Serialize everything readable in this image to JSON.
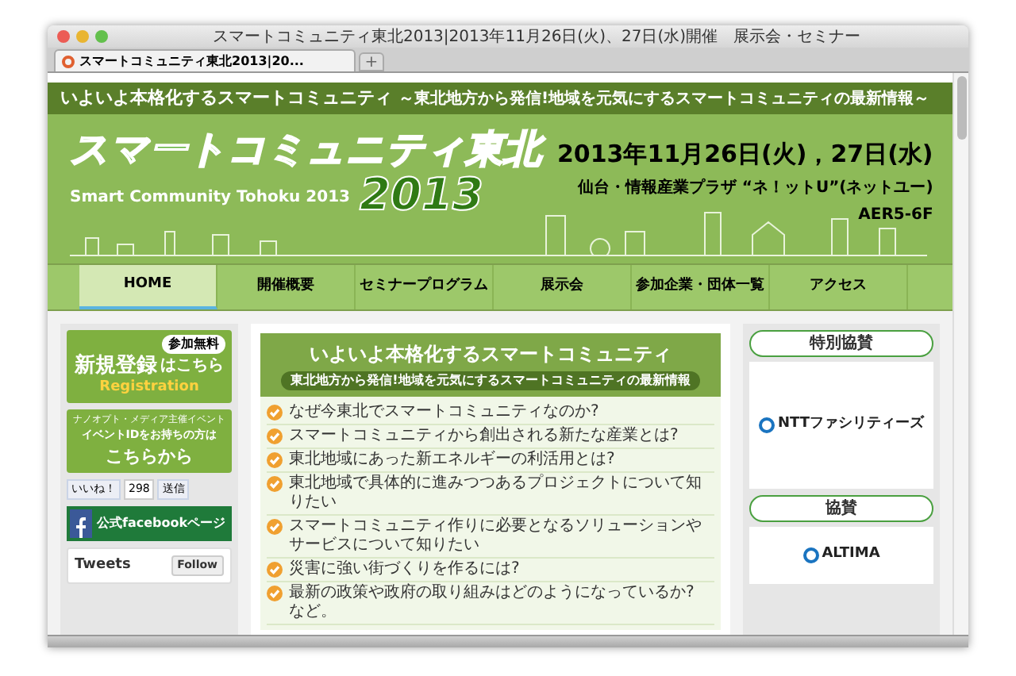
{
  "window": {
    "title": "スマートコミュニティ東北2013|2013年11月26日(火)、27日(水)開催　展示会・セミナー",
    "tab": "スマートコミュニティ東北2013|20...",
    "new_tab": "+"
  },
  "header": {
    "tagline": "いよいよ本格化するスマートコミュニティ",
    "tagline_sub": "～東北地方から発信!地域を元気にするスマートコミュニティの最新情報～",
    "logo_title": "スマートコミュニティ東北",
    "logo_subtitle": "Smart Community Tohoku 2013",
    "logo_year": "2013",
    "date": "2013年11月26日(火)，27日(水)",
    "venue": "仙台・情報産業プラザ “ネ！ットU”(ネットユー)",
    "room": "AER5-6F"
  },
  "nav": [
    {
      "label": "HOME",
      "selected": true
    },
    {
      "label": "開催概要",
      "selected": false
    },
    {
      "label": "セミナープログラム",
      "selected": false
    },
    {
      "label": "展示会",
      "selected": false
    },
    {
      "label": "参加企業・団体一覧",
      "selected": false
    },
    {
      "label": "アクセス",
      "selected": false
    }
  ],
  "left": {
    "register": {
      "badge": "参加無料",
      "title": "新規登録",
      "suffix": "はこちら",
      "sub": "Registration"
    },
    "event_id": {
      "line_1": "ナノオプト・メディア主催イベント",
      "line_2": "イベントIDをお持ちの方は",
      "line_3": "こちらから"
    },
    "like": {
      "label": "いいね！",
      "count": "298",
      "send": "送信"
    },
    "facebook": "公式facebookページ",
    "twitter": {
      "title": "Tweets",
      "follow": "Follow"
    }
  },
  "center": {
    "title": "いよいよ本格化するスマートコミュニティ",
    "subtitle": "東北地方から発信!地域を元気にするスマートコミュニティの最新情報",
    "items": [
      "なぜ今東北でスマートコミュニティなのか?",
      "スマートコミュニティから創出される新たな産業とは?",
      "東北地域にあった新エネルギーの利活用とは?",
      "東北地域で具体的に進みつつあるプロジェクトについて知りたい",
      "スマートコミュニティ作りに必要となるソリューションやサービスについて知りたい",
      "災害に強い街づくりを作るには?",
      "最新の政策や政府の取り組みはどのようになっているか?　など。"
    ]
  },
  "sponsors": [
    {
      "heading": "特別協賛",
      "logo": "NTTファシリティーズ"
    },
    {
      "heading": "協賛",
      "logo": "ALTIMA"
    }
  ]
}
